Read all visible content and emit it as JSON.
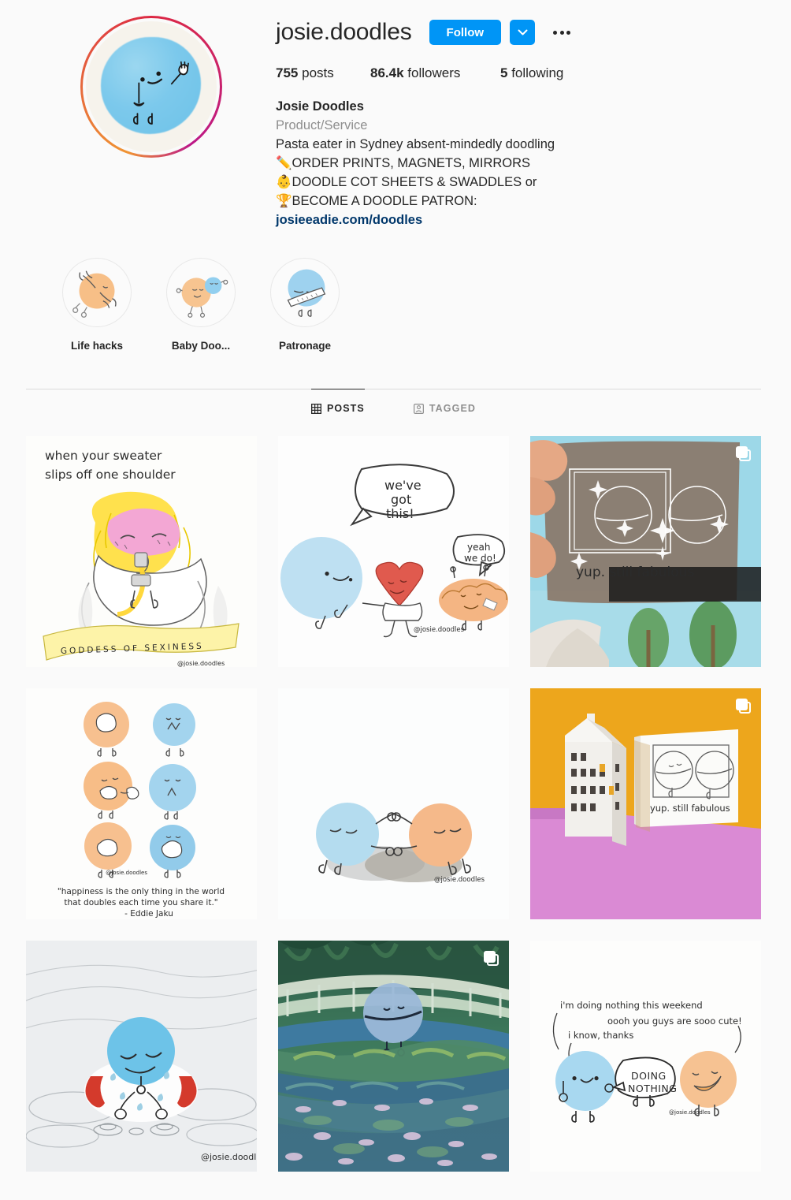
{
  "profile": {
    "username": "josie.doodles",
    "follow_label": "Follow",
    "chevron_icon": "chevron-down-icon",
    "more_icon": "more-options-icon",
    "avatar_icon": "profile-avatar-doodle",
    "stats": {
      "posts_count": "755",
      "posts_label": "posts",
      "followers_count": "86.4k",
      "followers_label": "followers",
      "following_count": "5",
      "following_label": "following"
    },
    "bio": {
      "display_name": "Josie Doodles",
      "category": "Product/Service",
      "line1": "Pasta eater in Sydney absent-mindedly doodling",
      "line2_emoji": "✏️",
      "line2": "ORDER PRINTS, MAGNETS, MIRRORS",
      "line3_emoji": "👶",
      "line3": "DOODLE COT SHEETS & SWADDLES or",
      "line4_emoji": "🏆",
      "line4": "BECOME A DOODLE PATRON:",
      "link": "josieeadie.com/doodles"
    }
  },
  "highlights": [
    {
      "label": "Life hacks",
      "icon": "highlight-life-hacks"
    },
    {
      "label": "Baby Doo...",
      "icon": "highlight-baby-doodles"
    },
    {
      "label": "Patronage",
      "icon": "highlight-patronage"
    }
  ],
  "tabs": [
    {
      "label": "POSTS",
      "icon": "grid-icon",
      "active": true
    },
    {
      "label": "TAGGED",
      "icon": "tagged-person-icon",
      "active": false
    }
  ],
  "posts": [
    {
      "id": "post-sweater-shoulder",
      "type": "image",
      "carousel": false,
      "caption_line1": "when your sweater",
      "caption_line2": "slips off one shoulder",
      "banner_text": "GODDESS OF SEXINESS",
      "watermark": "@josie.doodles"
    },
    {
      "id": "post-weve-got-this",
      "type": "image",
      "carousel": false,
      "bubble1": "we've",
      "bubble1b": "got",
      "bubble1c": "this!",
      "bubble2": "yeah",
      "bubble2b": "we do!",
      "watermark": "@josie.doodles"
    },
    {
      "id": "post-mirror-fabulous",
      "type": "carousel",
      "carousel": true,
      "mirror_text": "yup. still fabulous"
    },
    {
      "id": "post-happiness-quote",
      "type": "image",
      "carousel": false,
      "quote_line1": "\"happiness is the only thing in the world",
      "quote_line2": "that doubles each time you share it.\"",
      "quote_author": "- Eddie Jaku",
      "watermark": "@josie.doodles"
    },
    {
      "id": "post-two-blobs-shadow",
      "type": "image",
      "carousel": false,
      "watermark": "@josie.doodles"
    },
    {
      "id": "post-house-mirror-product",
      "type": "carousel",
      "carousel": true,
      "mirror_text": "yup. still fabulous"
    },
    {
      "id": "post-life-ring-crying",
      "type": "image",
      "carousel": false,
      "watermark": "@josie.doodles"
    },
    {
      "id": "post-monet-bridge",
      "type": "carousel",
      "carousel": true
    },
    {
      "id": "post-doing-nothing",
      "type": "image",
      "carousel": false,
      "text1": "i'm doing nothing this weekend",
      "text2": "oooh you guys are sooo cute!",
      "text3": "i know, thanks",
      "bubble_line1": "DOING",
      "bubble_line2": "NOTHING",
      "watermark": "@josie.doodles"
    }
  ],
  "colors": {
    "accent_blue": "#0095f6",
    "link_blue": "#00376b",
    "text_primary": "#262626",
    "text_secondary": "#8e8e8e",
    "background": "#fafafa",
    "blob_blue": "#7cc9ec",
    "blob_orange": "#f5b97d",
    "heart_red": "#d94c42"
  }
}
